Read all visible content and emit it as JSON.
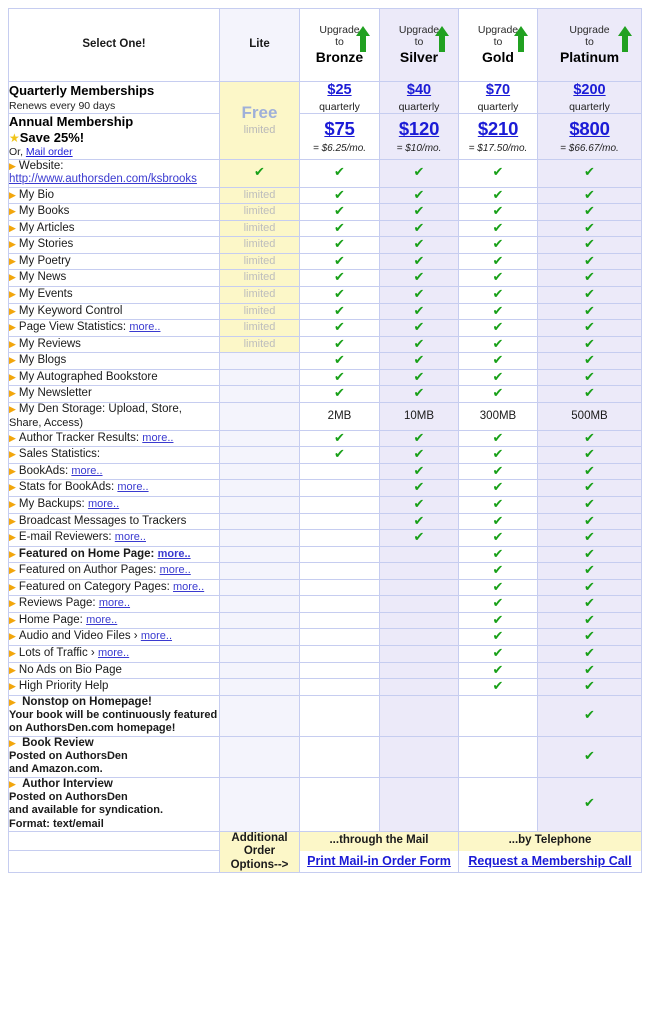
{
  "table": {
    "header": {
      "select_one": "Select One!",
      "lite": "Lite",
      "upgrade_line1": "Upgrade",
      "upgrade_line2": "to",
      "arrow_icon": "green-up-arrow-icon",
      "plans": [
        "Bronze",
        "Silver",
        "Gold",
        "Platinum"
      ]
    },
    "pricing": {
      "quarterly": {
        "title": "Quarterly Memberships",
        "subtitle": "Renews every 90 days",
        "period_label": "quarterly",
        "values": [
          "$25",
          "$40",
          "$70",
          "$200"
        ]
      },
      "annual": {
        "title": "Annual Membership",
        "save": "Save 25%!",
        "star_icon": "gold-star-icon",
        "or_text": "Or,",
        "mail_order_link": "Mail order",
        "values": [
          "$75",
          "$120",
          "$210",
          "$800"
        ],
        "monthly": [
          "= $6.25/mo.",
          "= $10/mo.",
          "= $17.50/mo.",
          "= $66.67/mo."
        ]
      },
      "lite": {
        "free": "Free",
        "limited": "limited"
      }
    },
    "check_glyph": "✔",
    "bullet_glyph": "▶",
    "limited_label": "limited",
    "rows": [
      {
        "label": "Website:",
        "url": "http://www.authorsden.com/ksbrooks",
        "type": "website",
        "lite": "check",
        "cells": [
          "check",
          "check",
          "check",
          "check"
        ]
      },
      {
        "label": "My Bio",
        "lite": "limited",
        "cells": [
          "check",
          "check",
          "check",
          "check"
        ]
      },
      {
        "label": "My Books",
        "lite": "limited",
        "cells": [
          "check",
          "check",
          "check",
          "check"
        ]
      },
      {
        "label": "My Articles",
        "lite": "limited",
        "cells": [
          "check",
          "check",
          "check",
          "check"
        ]
      },
      {
        "label": "My Stories",
        "lite": "limited",
        "cells": [
          "check",
          "check",
          "check",
          "check"
        ]
      },
      {
        "label": "My Poetry",
        "lite": "limited",
        "cells": [
          "check",
          "check",
          "check",
          "check"
        ]
      },
      {
        "label": "My News",
        "lite": "limited",
        "cells": [
          "check",
          "check",
          "check",
          "check"
        ]
      },
      {
        "label": "My Events",
        "lite": "limited",
        "cells": [
          "check",
          "check",
          "check",
          "check"
        ]
      },
      {
        "label": "My Keyword Control",
        "lite": "limited",
        "cells": [
          "check",
          "check",
          "check",
          "check"
        ]
      },
      {
        "label": "Page View Statistics:",
        "more": "more..",
        "lite": "limited",
        "cells": [
          "check",
          "check",
          "check",
          "check"
        ]
      },
      {
        "label": "My Reviews",
        "lite": "limited",
        "cells": [
          "check",
          "check",
          "check",
          "check"
        ]
      },
      {
        "label": "My Blogs",
        "lite": "",
        "cells": [
          "check",
          "check",
          "check",
          "check"
        ]
      },
      {
        "label": "My Autographed Bookstore",
        "lite": "",
        "cells": [
          "check",
          "check",
          "check",
          "check"
        ]
      },
      {
        "label": "My Newsletter",
        "lite": "",
        "cells": [
          "check",
          "check",
          "check",
          "check"
        ]
      },
      {
        "label": "My Den Storage: Upload, Store,",
        "label2": "Share, Access)",
        "type": "twoline",
        "lite": "",
        "cells": [
          "2MB",
          "10MB",
          "300MB",
          "500MB"
        ]
      },
      {
        "label": "Author Tracker Results:",
        "more": "more..",
        "lite": "",
        "cells": [
          "check",
          "check",
          "check",
          "check"
        ]
      },
      {
        "label": "Sales Statistics:",
        "lite": "",
        "cells": [
          "check",
          "check",
          "check",
          "check"
        ]
      },
      {
        "label": "BookAds:",
        "more": "more..",
        "lite": "",
        "cells": [
          "",
          "check",
          "check",
          "check"
        ]
      },
      {
        "label": "Stats for BookAds:",
        "more": "more..",
        "lite": "",
        "cells": [
          "",
          "check",
          "check",
          "check"
        ]
      },
      {
        "label": "My Backups:",
        "more": "more..",
        "lite": "",
        "cells": [
          "",
          "check",
          "check",
          "check"
        ]
      },
      {
        "label": "Broadcast Messages to Trackers",
        "lite": "",
        "cells": [
          "",
          "check",
          "check",
          "check"
        ]
      },
      {
        "label": "E-mail Reviewers:",
        "more": "more..",
        "lite": "",
        "cells": [
          "",
          "check",
          "check",
          "check"
        ]
      },
      {
        "label": "Featured on Home Page:",
        "more": "more..",
        "bold": true,
        "lite": "",
        "cells": [
          "",
          "",
          "check",
          "check"
        ]
      },
      {
        "label": "Featured on Author Pages:",
        "more": "more..",
        "lite": "",
        "cells": [
          "",
          "",
          "check",
          "check"
        ]
      },
      {
        "label": "Featured on Category Pages:",
        "more": "more..",
        "lite": "",
        "cells": [
          "",
          "",
          "check",
          "check"
        ]
      },
      {
        "label": "Reviews Page:",
        "more": "more..",
        "lite": "",
        "cells": [
          "",
          "",
          "check",
          "check"
        ]
      },
      {
        "label": "Home Page:",
        "more": "more..",
        "lite": "",
        "cells": [
          "",
          "",
          "check",
          "check"
        ]
      },
      {
        "label": "Audio and Video Files ›",
        "more": "more..",
        "lite": "",
        "cells": [
          "",
          "",
          "check",
          "check"
        ]
      },
      {
        "label": "Lots of Traffic ›",
        "more": "more..",
        "lite": "",
        "cells": [
          "",
          "",
          "check",
          "check"
        ]
      },
      {
        "label": "No Ads on Bio Page",
        "lite": "",
        "cells": [
          "",
          "",
          "check",
          "check"
        ]
      },
      {
        "label": "High Priority Help",
        "lite": "",
        "cells": [
          "",
          "",
          "check",
          "check"
        ]
      },
      {
        "label": "Nonstop on Homepage!",
        "bold": true,
        "type": "block",
        "lines": [
          "Your book will be continuously featured",
          "on AuthorsDen.com homepage!"
        ],
        "lite": "",
        "cells": [
          "",
          "",
          "",
          "check"
        ]
      },
      {
        "label": "Book Review",
        "bold": true,
        "type": "block",
        "lines": [
          "Posted on AuthorsDen",
          "and Amazon.com."
        ],
        "lite": "",
        "cells": [
          "",
          "",
          "",
          "check"
        ]
      },
      {
        "label": "Author Interview",
        "bold": true,
        "type": "block",
        "lines": [
          "Posted on AuthorsDen",
          "and available for syndication.",
          "Format: text/email"
        ],
        "lite": "",
        "cells": [
          "",
          "",
          "",
          "check"
        ]
      }
    ],
    "footer": {
      "label_line1": "Additional Order",
      "label_line2": "Options-->",
      "mail_heading": "...through the Mail",
      "mail_link": "Print Mail-in Order Form",
      "phone_heading": "...by Telephone",
      "phone_link": "Request a Membership Call"
    }
  },
  "colors": {
    "link": "#1b1bd6",
    "check_green": "#18a018",
    "bullet_orange": "#f2a60c",
    "yellow": "#fcf7c8",
    "lavender": "#eceaf9",
    "border": "#c6cdf0"
  }
}
